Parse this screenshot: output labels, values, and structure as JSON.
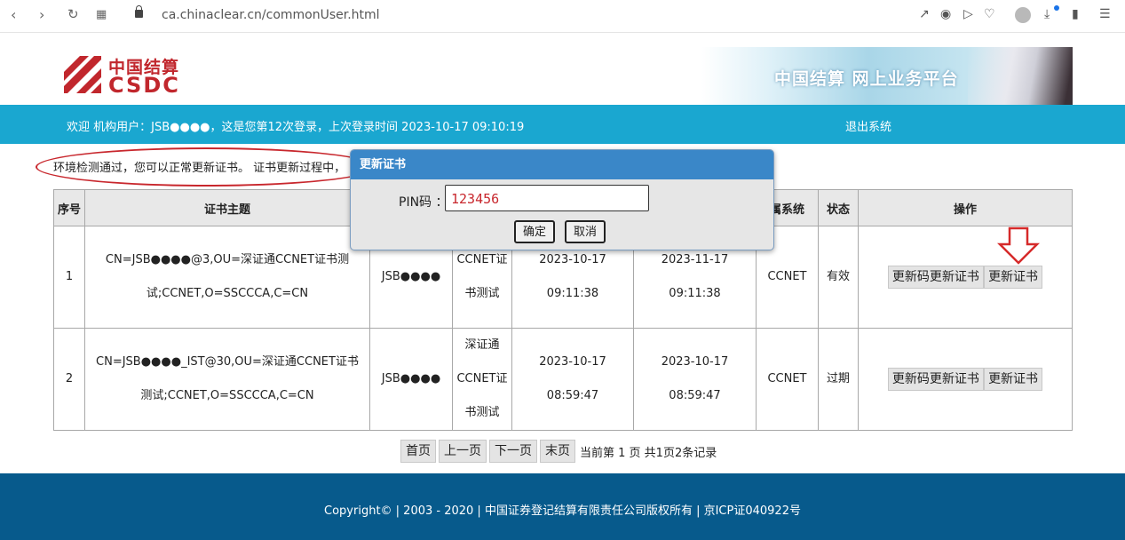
{
  "browser": {
    "url": "ca.chinaclear.cn/commonUser.html"
  },
  "header": {
    "logo_cn": "中国结算",
    "logo_en": "CSDC",
    "banner_text": "中国结算 网上业务平台"
  },
  "topbar": {
    "welcome": "欢迎 机构用户：JSB●●●●，这是您第12次登录，上次登录时间 2023-10-17 09:10:19",
    "logout": "退出系统"
  },
  "notice": "环境检测通过，您可以正常更新证书。 证书更新过程中，",
  "table": {
    "headers": [
      "序号",
      "证书主题",
      "",
      "",
      "",
      "",
      "属系统",
      "状态",
      "操作"
    ],
    "rows": [
      {
        "index": "1",
        "subject": "CN=JSB●●●●@3,OU=深证通CCNET证书测试;CCNET,O=SSCCCA,C=CN",
        "user": "JSB●●●●",
        "issuer": "CCNET证书测试",
        "start": "2023-10-17 09:11:38",
        "end": "2023-11-17 09:11:38",
        "system": "CCNET",
        "status": "有效",
        "btn_pin": "更新码更新证书",
        "btn_update": "更新证书"
      },
      {
        "index": "2",
        "subject": "CN=JSB●●●●_IST@30,OU=深证通CCNET证书测试;CCNET,O=SSCCCA,C=CN",
        "user": "JSB●●●●",
        "issuer": "深证通CCNET证书测试",
        "start": "2023-10-17 08:59:47",
        "end": "2023-10-17 08:59:47",
        "system": "CCNET",
        "status": "过期",
        "btn_pin": "更新码更新证书",
        "btn_update": "更新证书"
      }
    ]
  },
  "pager": {
    "first": "首页",
    "prev": "上一页",
    "next": "下一页",
    "last": "末页",
    "info": "当前第 1 页 共1页2条记录"
  },
  "footer": {
    "copyright": "Copyright© | 2003 - 2020 | 中国证券登记结算有限责任公司版权所有 | 京ICP证040922号"
  },
  "dialog": {
    "title": "更新证书",
    "pin_label": "PIN码 ：",
    "pin_value": "123456",
    "confirm": "确定",
    "cancel": "取消"
  },
  "colors": {
    "topbar": "#1aa7d0",
    "footer": "#075a8c",
    "dialog_title": "#3a87c8",
    "brand_red": "#c1272d"
  },
  "icons": [
    "back-icon",
    "forward-icon",
    "reload-icon",
    "apps-icon",
    "lock-icon",
    "share-icon",
    "screenshot-icon",
    "send-icon",
    "heart-icon",
    "avatar-icon",
    "download-icon",
    "battery-icon",
    "menu-icon"
  ]
}
